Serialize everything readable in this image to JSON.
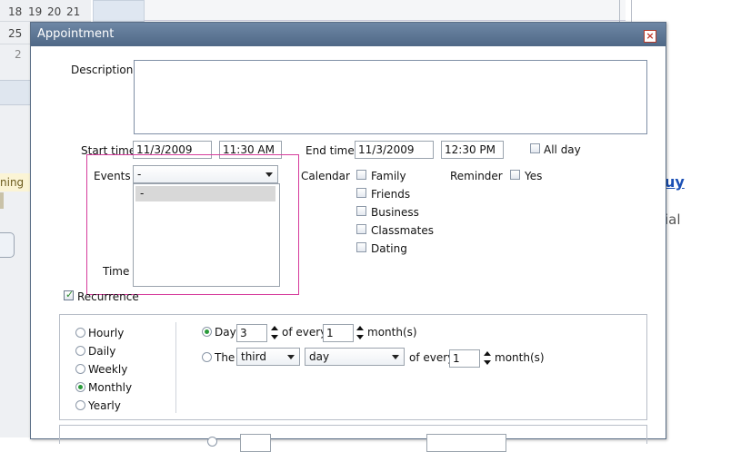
{
  "background": {
    "week_rows": [
      {
        "numbers": [
          "18",
          "19",
          "20",
          "21"
        ]
      },
      {
        "numbers": [
          "25"
        ]
      },
      {
        "numbers": [
          "2"
        ]
      }
    ],
    "left_cut_text": "ning",
    "right_link_text": "uy",
    "right_cut_text": "ial"
  },
  "dialog": {
    "title": "Appointment",
    "close_glyph": "×",
    "description": {
      "label": "Description",
      "value": ""
    },
    "start": {
      "label": "Start time",
      "date": "11/3/2009",
      "time": "11:30 AM"
    },
    "end": {
      "label": "End time",
      "date": "11/3/2009",
      "time": "12:30 PM"
    },
    "all_day": {
      "label": "All day",
      "checked": false
    },
    "events": {
      "label": "Events",
      "selected": "-",
      "options": [
        "-"
      ]
    },
    "time_label": "Time",
    "calendar": {
      "label": "Calendar",
      "items": [
        {
          "label": "Family",
          "checked": false
        },
        {
          "label": "Friends",
          "checked": false
        },
        {
          "label": "Business",
          "checked": false
        },
        {
          "label": "Classmates",
          "checked": false
        },
        {
          "label": "Dating",
          "checked": false
        }
      ]
    },
    "reminder": {
      "label": "Reminder",
      "option_label": "Yes",
      "checked": false
    },
    "recurrence": {
      "label": "Recurrence",
      "checked": true,
      "frequencies": [
        {
          "label": "Hourly",
          "selected": false
        },
        {
          "label": "Daily",
          "selected": false
        },
        {
          "label": "Weekly",
          "selected": false
        },
        {
          "label": "Monthly",
          "selected": true
        },
        {
          "label": "Yearly",
          "selected": false
        }
      ],
      "day_option": {
        "label": "Day",
        "selected": true,
        "day_value": "3",
        "of_every": "of every",
        "interval": "1",
        "unit": "month(s)"
      },
      "the_option": {
        "label": "The",
        "selected": false,
        "ordinal": "third",
        "unit_select": "day",
        "of_every": "of every",
        "interval": "1",
        "unit": "month(s)"
      }
    }
  }
}
